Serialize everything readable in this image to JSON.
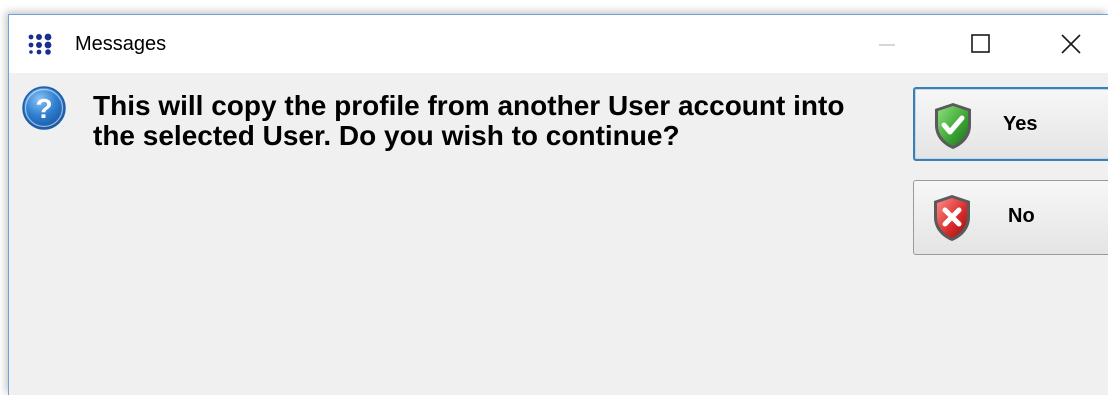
{
  "window": {
    "title": "Messages",
    "app_icon": "dots-grid-icon",
    "controls": {
      "minimize_icon": "minimize-icon",
      "maximize_icon": "maximize-icon",
      "close_icon": "close-icon"
    }
  },
  "dialog": {
    "icon": "question-icon",
    "message": "This will copy the profile from another User account into the selected User. Do you wish to continue?",
    "buttons": {
      "yes": {
        "label": "Yes",
        "icon": "green-check-shield-icon"
      },
      "no": {
        "label": "No",
        "icon": "red-x-shield-icon"
      }
    }
  },
  "colors": {
    "titlebar_bg": "#ffffff",
    "body_bg": "#f0f0f0",
    "window_border": "#6fa2d8",
    "focus_border": "#3c7fb1",
    "question_blue": "#2f7fd0",
    "yes_green": "#3aa335",
    "no_red": "#d82a2a"
  }
}
